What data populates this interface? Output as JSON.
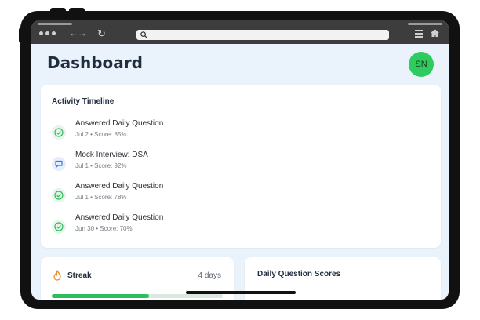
{
  "header": {
    "title": "Dashboard",
    "avatar_initials": "SN"
  },
  "timeline": {
    "title": "Activity Timeline",
    "items": [
      {
        "title": "Answered Daily Question",
        "subtitle": "Jul 2 • Score: 85%",
        "icon": "check-circle-icon"
      },
      {
        "title": "Mock Interview: DSA",
        "subtitle": "Jul 1 • Score: 92%",
        "icon": "chat-bubble-icon"
      },
      {
        "title": "Answered Daily Question",
        "subtitle": "Jul 1 • Score: 78%",
        "icon": "check-circle-icon"
      },
      {
        "title": "Answered Daily Question",
        "subtitle": "Jun 30 • Score: 70%",
        "icon": "check-circle-icon"
      }
    ]
  },
  "streak": {
    "title": "Streak",
    "value": "4 days",
    "progress": 0.57,
    "icon": "flame-icon"
  },
  "scores": {
    "title": "Daily Question Scores"
  },
  "colors": {
    "accent_green": "#2ecc5f",
    "accent_blue": "#2f7be8",
    "text_dark": "#1f2d3d",
    "background": "#eaf2fb"
  }
}
